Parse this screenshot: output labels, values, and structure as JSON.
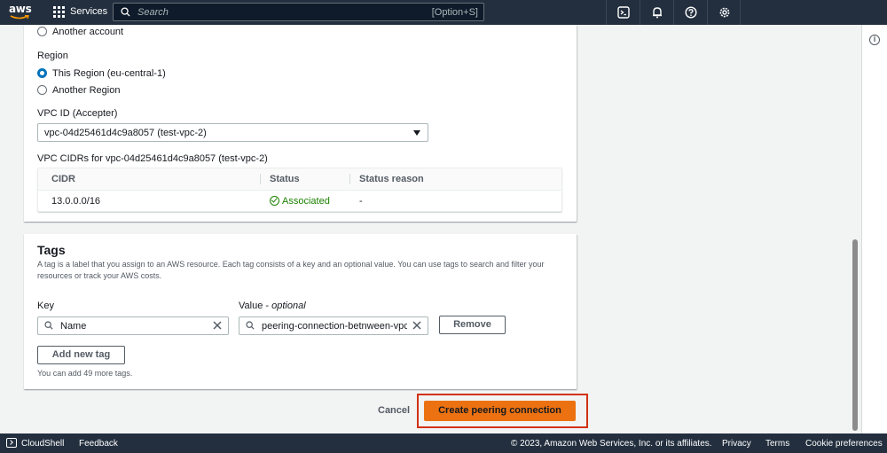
{
  "topnav": {
    "logo_text": "aws",
    "services_label": "Services",
    "search_placeholder": "Search",
    "search_shortcut": "[Option+S]",
    "icons": [
      "cloudshell-icon",
      "bell-icon",
      "help-icon",
      "gear-icon"
    ]
  },
  "accepter": {
    "account_options": [
      {
        "label": "Another account",
        "selected": false
      }
    ],
    "region_label": "Region",
    "region_options": [
      {
        "label": "This Region (eu-central-1)",
        "selected": true
      },
      {
        "label": "Another Region",
        "selected": false
      }
    ],
    "vpc_label": "VPC ID (Accepter)",
    "vpc_value": "vpc-04d25461d4c9a8057 (test-vpc-2)",
    "cidrs_label": "VPC CIDRs for vpc-04d25461d4c9a8057 (test-vpc-2)",
    "table": {
      "columns": [
        "CIDR",
        "Status",
        "Status reason"
      ],
      "rows": [
        {
          "cidr": "13.0.0.0/16",
          "status": "Associated",
          "reason": "-"
        }
      ]
    }
  },
  "tags": {
    "title": "Tags",
    "description": "A tag is a label that you assign to an AWS resource. Each tag consists of a key and an optional value. You can use tags to search and filter your resources or track your AWS costs.",
    "key_label": "Key",
    "value_label": "Value",
    "value_optional": "optional",
    "key_value": "Name",
    "value_value": "peering-connection-betnween-vpc",
    "remove_label": "Remove",
    "add_label": "Add new tag",
    "hint": "You can add 49 more tags."
  },
  "actions": {
    "cancel_label": "Cancel",
    "create_label": "Create peering connection"
  },
  "footer": {
    "cloudshell": "CloudShell",
    "feedback": "Feedback",
    "copyright": "© 2023, Amazon Web Services, Inc. or its affiliates.",
    "privacy": "Privacy",
    "terms": "Terms",
    "cookie": "Cookie preferences"
  },
  "colors": {
    "nav_bg": "#232f3e",
    "primary": "#ec7211",
    "highlight": "#d13212",
    "success": "#1d8102",
    "radio_selected": "#0073bb"
  }
}
